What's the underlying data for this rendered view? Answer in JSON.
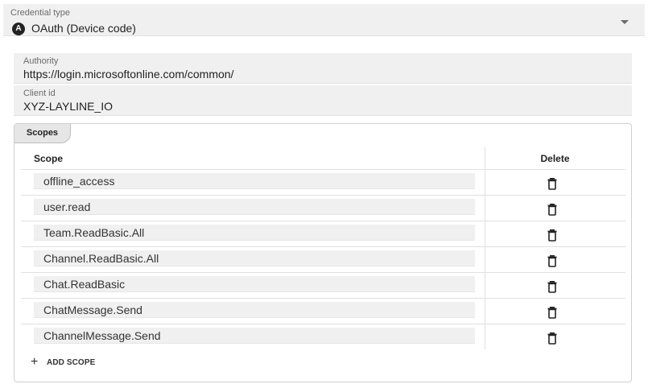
{
  "credential": {
    "label": "Credential type",
    "badge": "A",
    "value": "OAuth (Device code)",
    "icon": "chevron-down-icon"
  },
  "authority": {
    "label": "Authority",
    "value": "https://login.microsoftonline.com/common/"
  },
  "client": {
    "label": "Client id",
    "value": "XYZ-LAYLINE_IO"
  },
  "scopes": {
    "tab_label": "Scopes",
    "columns": {
      "scope": "Scope",
      "delete": "Delete"
    },
    "rows": [
      {
        "value": "offline_access",
        "icon": "trash-icon"
      },
      {
        "value": "user.read",
        "icon": "trash-icon"
      },
      {
        "value": "Team.ReadBasic.All",
        "icon": "trash-icon"
      },
      {
        "value": "Channel.ReadBasic.All",
        "icon": "trash-icon"
      },
      {
        "value": "Chat.ReadBasic",
        "icon": "trash-icon"
      },
      {
        "value": "ChatMessage.Send",
        "icon": "trash-icon"
      },
      {
        "value": "ChannelMessage.Send",
        "icon": "trash-icon"
      }
    ],
    "add_label": "ADD SCOPE",
    "add_symbol": "+"
  }
}
